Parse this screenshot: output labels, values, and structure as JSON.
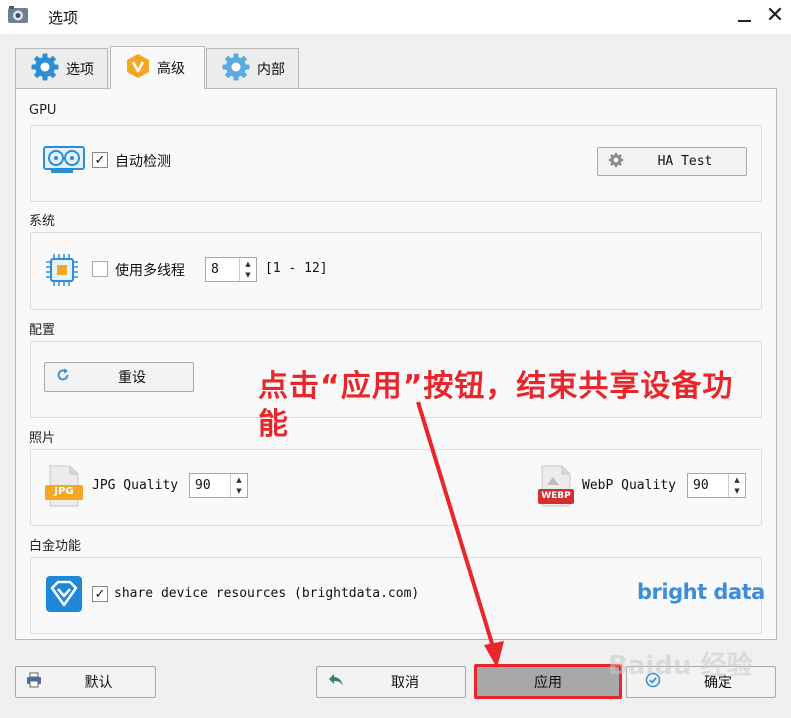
{
  "window": {
    "title": "选项"
  },
  "tabs": [
    {
      "label": "选项",
      "icon": "gear-icon",
      "active": false
    },
    {
      "label": "高级",
      "icon": "v-badge-icon",
      "active": true
    },
    {
      "label": "内部",
      "icon": "gear-icon",
      "active": false
    }
  ],
  "gpu": {
    "section_label": "GPU",
    "auto_detect_label": "自动检测",
    "auto_detect_checked": true,
    "ha_test_label": "HA Test"
  },
  "system": {
    "section_label": "系统",
    "multithread_label": "使用多线程",
    "multithread_checked": false,
    "threads_value": "8",
    "threads_range": "[1 - 12]"
  },
  "config": {
    "section_label": "配置",
    "reset_label": "重设"
  },
  "photo": {
    "section_label": "照片",
    "jpg_label": "JPG Quality",
    "jpg_value": "90",
    "jpg_icon_text": "JPG",
    "webp_label": "WebP Quality",
    "webp_value": "90",
    "webp_icon_text": "WEBP"
  },
  "platinum": {
    "section_label": "白金功能",
    "share_label": "share device resources (brightdata.com)",
    "share_checked": true,
    "brand": "bright data"
  },
  "buttons": {
    "default_label": "默认",
    "cancel_label": "取消",
    "apply_label": "应用",
    "ok_label": "确定"
  },
  "annotation": {
    "text": "点击“应用”按钮，结束共享设备功能"
  },
  "watermark": "Baidu 经验",
  "colors": {
    "annotation_red": "#e8262b",
    "gear_blue": "#2c8fd6",
    "badge_orange": "#f5a623",
    "brand_blue": "#3b8ed8"
  }
}
